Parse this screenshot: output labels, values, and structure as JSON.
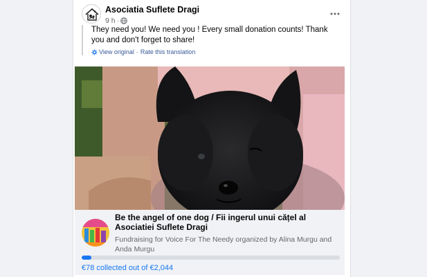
{
  "post": {
    "author": "Asociatia Suflete Dragi",
    "time": "9 h",
    "message": "They need you! We need you ! Every small donation counts! Thank you and don't forget to share!",
    "view_original": "View original",
    "separator": "·",
    "rate_translation": "Rate this translation"
  },
  "fundraiser": {
    "title": "Be the angel of one dog / Fii ingerul unui cățel al Asociatiei Suflete Dragi",
    "subtitle": "Fundraising for Voice For The Needy organized by Alina Murgu and Anda Murgu",
    "collected_text": "€78 collected out of €2,044",
    "progress_fraction": 0.038
  },
  "icons": {
    "globe": "globe-icon",
    "more": "more-options-icon",
    "translate": "gear-icon"
  },
  "colors": {
    "link": "#385898",
    "accent": "#1877f2",
    "muted": "#65676b"
  }
}
